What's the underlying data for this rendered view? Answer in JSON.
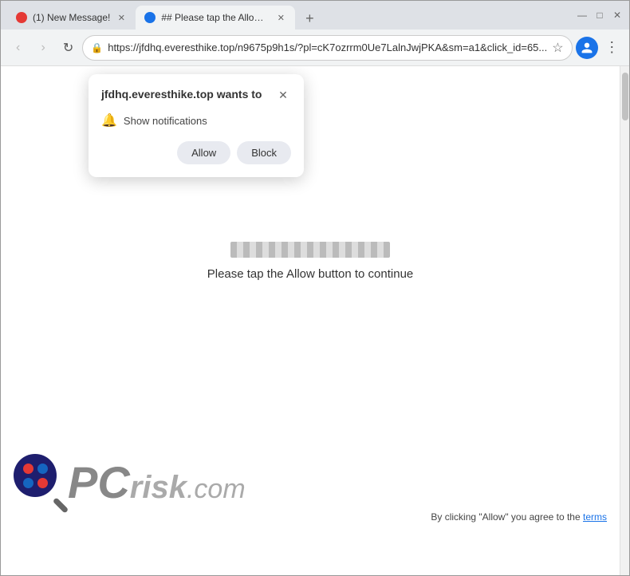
{
  "browser": {
    "tabs": [
      {
        "id": "tab1",
        "favicon": "notification-icon",
        "title": "(1) New Message!",
        "active": false,
        "closable": true
      },
      {
        "id": "tab2",
        "favicon": "globe-icon",
        "title": "## Please tap the Allow button...",
        "active": true,
        "closable": true
      }
    ],
    "new_tab_label": "+",
    "window_controls": {
      "minimize": "—",
      "maximize": "□",
      "close": "✕"
    },
    "nav": {
      "back_title": "Back",
      "forward_title": "Forward",
      "reload_title": "Reload",
      "url": "https://jfdhq.everesthike.top/n9675p9h1s/?pl=cK7ozrrm0Ue7LalnJwjPKA&sm=a1&click_id=65...",
      "lock_icon": "🔒",
      "star_icon": "☆"
    }
  },
  "popup": {
    "title": "jfdhq.everesthike.top wants to",
    "close_label": "✕",
    "permission_text": "Show notifications",
    "allow_label": "Allow",
    "block_label": "Block"
  },
  "page": {
    "instruction_text": "Please tap the Allow button to continue"
  },
  "footer": {
    "disclaimer": "By clicking \"Allow\" you agree to the",
    "terms_link": "terms"
  }
}
